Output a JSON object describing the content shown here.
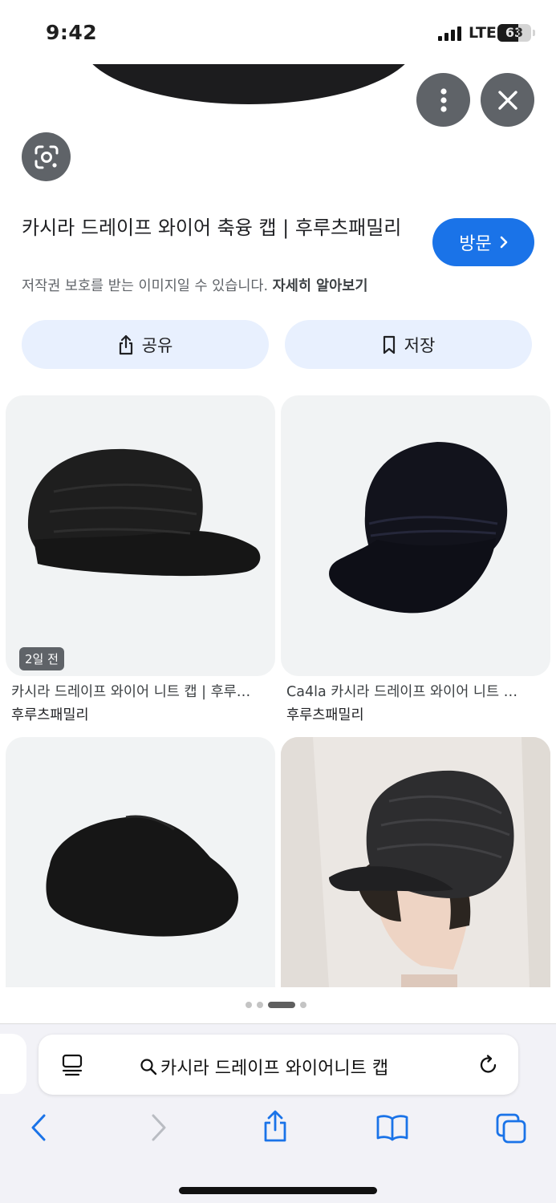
{
  "status_bar": {
    "time": "9:42",
    "network": "LTE",
    "battery": "63",
    "battery_level": 0.63
  },
  "hero": {
    "more_icon": "more-vert-icon",
    "close_icon": "close-icon",
    "lens_icon": "google-lens-icon"
  },
  "result": {
    "title": "카시라 드레이프 와이어 축융 캡 | 후루츠패밀리",
    "visit_label": "방문",
    "copyright_text": "저작권 보호를 받는 이미지일 수 있습니다.",
    "learn_more": "자세히 알아보기",
    "share_label": "공유",
    "save_label": "저장"
  },
  "related": [
    {
      "title": "카시라 드레이프 와이어 니트 캡 | 후루…",
      "source": "후루츠패밀리",
      "age": "2일 전"
    },
    {
      "title": "Ca4la 카시라 드레이프 와이어 니트 …",
      "source": "후루츠패밀리"
    },
    {
      "title": "",
      "source": ""
    },
    {
      "title": "",
      "source": ""
    }
  ],
  "pager": {
    "count": 4,
    "active": 2
  },
  "browser": {
    "query": "카시라 드레이프 와이어니트 캡",
    "icons": [
      "reader-icon",
      "search-icon",
      "reload-icon",
      "back-icon",
      "forward-icon",
      "share-icon",
      "bookmarks-icon",
      "tabs-icon"
    ]
  }
}
